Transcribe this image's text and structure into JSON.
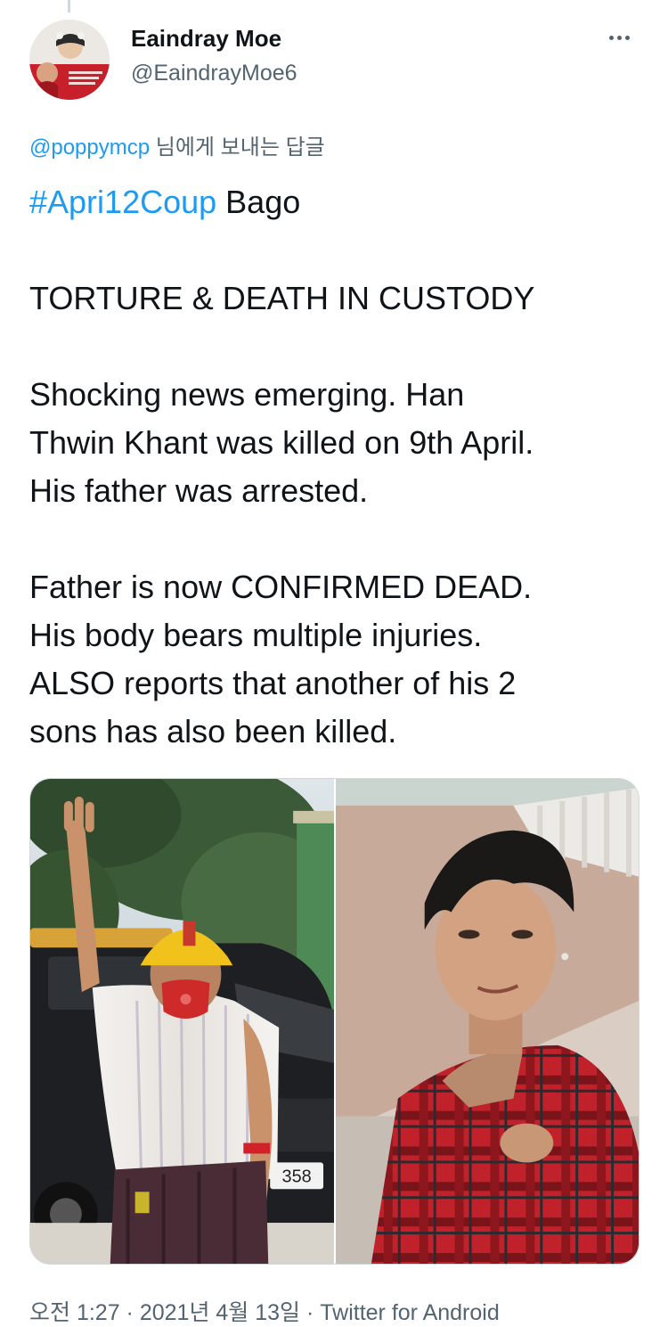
{
  "author": {
    "name": "Eaindray Moe",
    "handle": "@EaindrayMoe6",
    "avatar_icon": "profile-photo"
  },
  "more_icon": "more-horizontal-icon",
  "reply_to": {
    "mention": "@poppymcp",
    "suffix": " 님에게 보내는 답글"
  },
  "tweet": {
    "hashtag": "#Apri12Coup",
    "hashtag_rest": " Bago",
    "headline": "TORTURE & DEATH IN CUSTODY",
    "para1_lines": [
      "Shocking news emerging. Han",
      "Thwin Khant was killed on 9th April.",
      "His father was arrested."
    ],
    "para2_lines": [
      "Father is now CONFIRMED DEAD.",
      "His body bears multiple injuries.",
      "ALSO reports that another of his 2",
      "sons has also been killed."
    ]
  },
  "media": {
    "photos": [
      {
        "name": "photo-father-three-finger-salute",
        "plate_text": "358"
      },
      {
        "name": "photo-son-red-plaid-shirt"
      }
    ]
  },
  "meta": {
    "time": "오전 1:27",
    "separator": " · ",
    "date": "2021년 4월 13일",
    "source": "Twitter for Android"
  },
  "colors": {
    "link": "#1d9bf0",
    "text": "#0f1419",
    "secondary": "#536471",
    "border": "#cfd9de"
  }
}
